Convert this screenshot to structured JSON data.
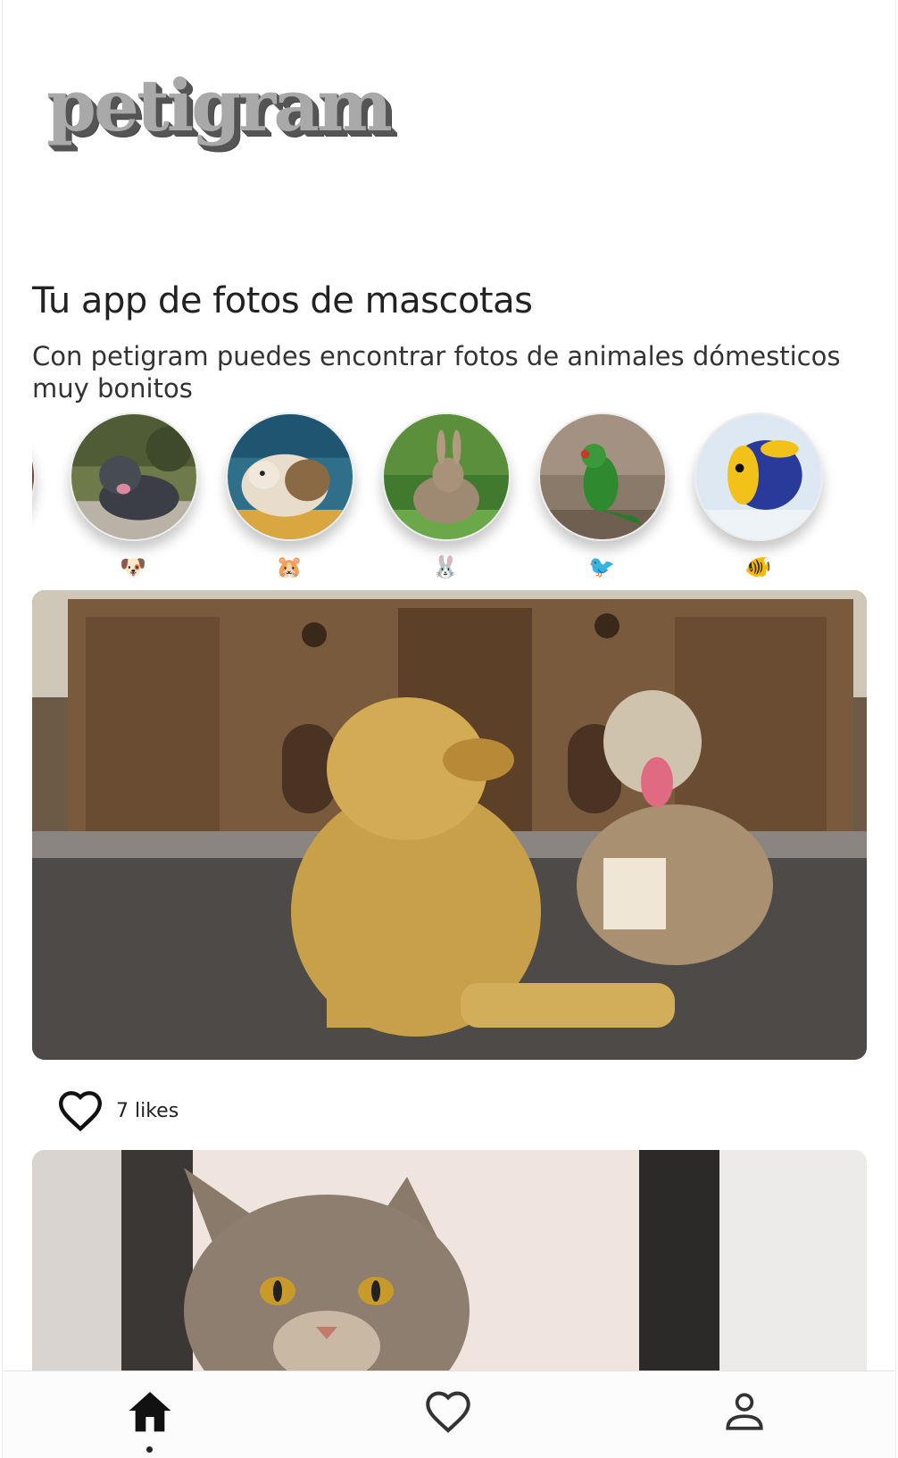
{
  "header": {
    "logo_text": "petigram"
  },
  "intro": {
    "title": "Tu app de fotos de mascotas",
    "subtitle": "Con petigram puedes encontrar fotos de animales dómesticos muy bonitos"
  },
  "categories": [
    {
      "name": "dog",
      "emoji": "🐶"
    },
    {
      "name": "hamster",
      "emoji": "🐹"
    },
    {
      "name": "rabbit",
      "emoji": "🐰"
    },
    {
      "name": "bird",
      "emoji": "🐦"
    },
    {
      "name": "fish",
      "emoji": "🐠"
    }
  ],
  "photos": [
    {
      "subject": "dogs",
      "likes_label": "7 likes"
    },
    {
      "subject": "cat"
    }
  ],
  "nav": {
    "items": [
      {
        "name": "home",
        "icon": "home-icon",
        "active": true
      },
      {
        "name": "favorites",
        "icon": "heart-icon",
        "active": false
      },
      {
        "name": "user",
        "icon": "user-icon",
        "active": false
      }
    ]
  },
  "colors": {
    "logo_fill": "#a9a9a9",
    "logo_shadow": "#555555",
    "text": "#222222",
    "nav_bg": "#fcfcfc"
  }
}
